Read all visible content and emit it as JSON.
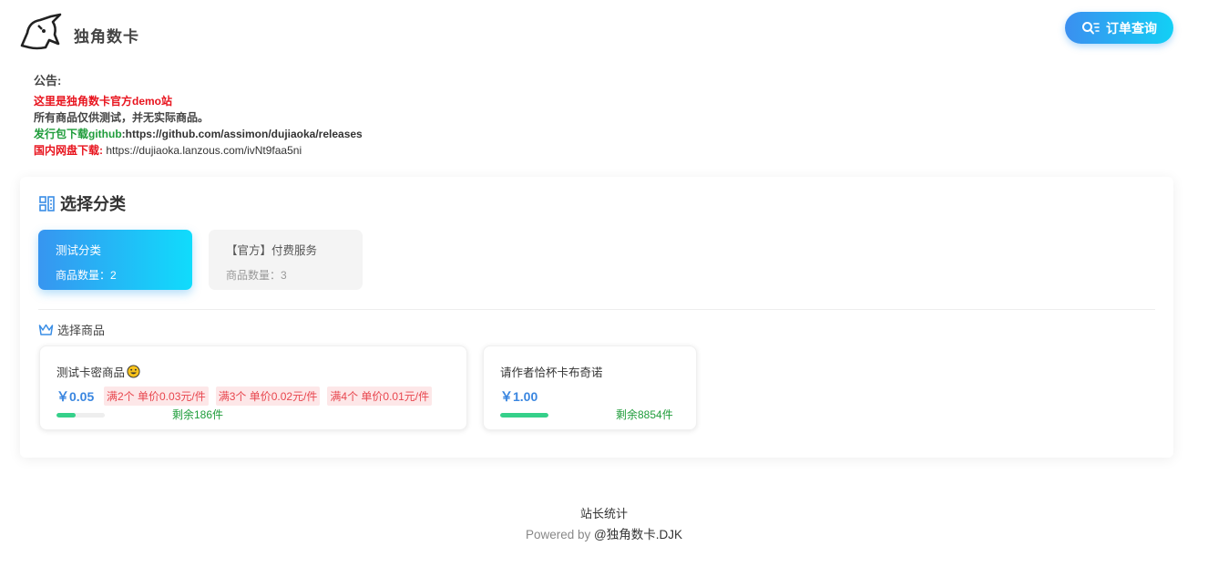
{
  "header": {
    "site_name": "独角数卡",
    "order_button_label": "订单查询",
    "logo_icon": "unicorn-logo-icon",
    "search_icon": "search-list-icon"
  },
  "notice": {
    "title": "公告:",
    "line1": "这里是独角数卡官方demo站",
    "line2": "所有商品仅供测试，并无实际商品。",
    "line3_label": "发行包下载github",
    "line3_url": ":https://github.com/assimon/dujiaoka/releases",
    "line4_label": "国内网盘下载:",
    "line4_url": " https://dujiaoka.lanzous.com/ivNt9faa5ni"
  },
  "categories": {
    "title": "选择分类",
    "items": [
      {
        "name": "测试分类",
        "count_label": "商品数量：2",
        "active": true
      },
      {
        "name": "【官方】付费服务",
        "count_label": "商品数量：3",
        "active": false
      }
    ]
  },
  "goods": {
    "title": "选择商品",
    "items": [
      {
        "name": "测试卡密商品",
        "price": "￥0.05",
        "tiers": [
          "满2个 单价0.03元/件",
          "满3个 单价0.02元/件",
          "满4个 单价0.01元/件"
        ],
        "stock_label": "剩余186件",
        "stock_fraction": 0.4
      },
      {
        "name": "请作者恰杯卡布奇诺",
        "price": "￥1.00",
        "tiers": [],
        "stock_label": "剩余8854件",
        "stock_fraction": 1.0
      }
    ]
  },
  "footer": {
    "stats": "站长统计",
    "powered_prefix": "Powered by ",
    "powered_brand": "@独角数卡.DJK"
  },
  "colors": {
    "accent_start": "#3795f0",
    "accent_end": "#10dcfc",
    "price": "#3a86e0",
    "stock_green": "#35d08a",
    "tier_red": "#e8464e"
  }
}
